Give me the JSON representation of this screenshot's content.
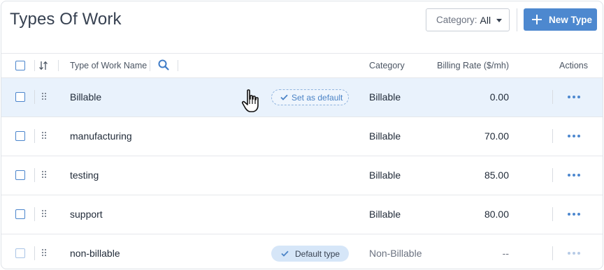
{
  "header": {
    "title": "Types Of Work",
    "category_filter": {
      "label": "Category:",
      "value": "All"
    },
    "new_type_label": "New Type"
  },
  "table": {
    "columns": {
      "name": "Type of Work Name",
      "category": "Category",
      "billing_rate": "Billing Rate ($/mh)",
      "actions": "Actions"
    },
    "rows": [
      {
        "name": "Billable",
        "category": "Billable",
        "rate": "0.00",
        "action": "Set as default"
      },
      {
        "name": "manufacturing",
        "category": "Billable",
        "rate": "70.00"
      },
      {
        "name": "testing",
        "category": "Billable",
        "rate": "85.00"
      },
      {
        "name": "support",
        "category": "Billable",
        "rate": "80.00"
      },
      {
        "name": "non-billable",
        "category": "Non-Billable",
        "rate": "--",
        "badge": "Default type"
      }
    ]
  },
  "colors": {
    "accent": "#4d88cf",
    "row_highlight": "#e9f2fc",
    "default_badge_bg": "#d6e6f8"
  },
  "icons": [
    "plus-icon",
    "chevron-down-icon",
    "sort-icon",
    "search-icon",
    "drag-handle-icon",
    "more-icon",
    "check-icon",
    "hand-cursor-icon"
  ]
}
